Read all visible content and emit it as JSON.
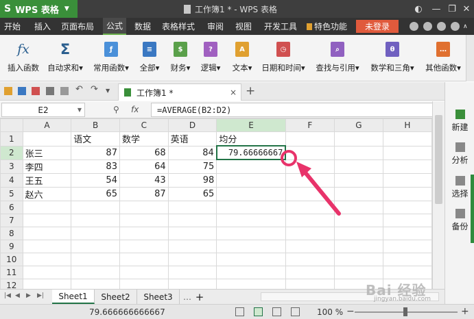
{
  "app": {
    "logo": "S",
    "name": "WPS 表格",
    "doc_title": "工作簿1 * - WPS 表格"
  },
  "menu": {
    "items": [
      "开始",
      "插入",
      "页面布局",
      "公式",
      "数据",
      "表格样式",
      "审阅",
      "视图",
      "开发工具",
      "特色功能"
    ],
    "active_index": 3,
    "login": "未登录"
  },
  "ribbon": {
    "buttons": [
      {
        "label": "插入函数",
        "icon": "fx-icon",
        "glyph": "fx",
        "color": "#2b5f8f"
      },
      {
        "label": "自动求和▾",
        "icon": "sigma-icon",
        "glyph": "Σ",
        "color": "#2b5f8f"
      },
      {
        "label": "常用函数▾",
        "icon": "common-func-icon",
        "glyph": "ƒ",
        "color": "#4a90d9"
      },
      {
        "label": "全部▾",
        "icon": "all-func-icon",
        "glyph": "≡",
        "color": "#3a78c2"
      },
      {
        "label": "财务▾",
        "icon": "finance-icon",
        "glyph": "$",
        "color": "#5aa04a"
      },
      {
        "label": "逻辑▾",
        "icon": "logic-icon",
        "glyph": "?",
        "color": "#a060c0"
      },
      {
        "label": "文本▾",
        "icon": "text-icon",
        "glyph": "A",
        "color": "#e0a030"
      },
      {
        "label": "日期和时间▾",
        "icon": "datetime-icon",
        "glyph": "◷",
        "color": "#d05050"
      },
      {
        "label": "查找与引用▾",
        "icon": "lookup-icon",
        "glyph": "⌕",
        "color": "#9060c0"
      },
      {
        "label": "数学和三角▾",
        "icon": "math-icon",
        "glyph": "θ",
        "color": "#7060c0"
      },
      {
        "label": "其他函数▾",
        "icon": "other-func-icon",
        "glyph": "…",
        "color": "#e07030"
      }
    ]
  },
  "tabs": {
    "doc_tab": "工作簿1 *",
    "close": "×",
    "new": "+"
  },
  "formula_bar": {
    "cell_ref": "E2",
    "fx": "fx",
    "formula": "=AVERAGE(B2:D2)"
  },
  "grid": {
    "columns": [
      "A",
      "B",
      "C",
      "D",
      "E",
      "F",
      "G",
      "H"
    ],
    "selected_column": "E",
    "selected_row": 2,
    "rows": [
      [
        "",
        "语文",
        "数学",
        "英语",
        "均分",
        "",
        "",
        ""
      ],
      [
        "张三",
        "87",
        "68",
        "84",
        "79.66666667",
        "",
        "",
        ""
      ],
      [
        "李四",
        "83",
        "64",
        "75",
        "",
        "",
        "",
        ""
      ],
      [
        "王五",
        "54",
        "43",
        "98",
        "",
        "",
        "",
        ""
      ],
      [
        "赵六",
        "65",
        "87",
        "65",
        "",
        "",
        "",
        ""
      ],
      [
        "",
        "",
        "",
        "",
        "",
        "",
        "",
        ""
      ],
      [
        "",
        "",
        "",
        "",
        "",
        "",
        "",
        ""
      ],
      [
        "",
        "",
        "",
        "",
        "",
        "",
        "",
        ""
      ],
      [
        "",
        "",
        "",
        "",
        "",
        "",
        "",
        ""
      ],
      [
        "",
        "",
        "",
        "",
        "",
        "",
        "",
        ""
      ],
      [
        "",
        "",
        "",
        "",
        "",
        "",
        "",
        ""
      ],
      [
        "",
        "",
        "",
        "",
        "",
        "",
        "",
        ""
      ]
    ]
  },
  "sheets": {
    "tabs": [
      "Sheet1",
      "Sheet2",
      "Sheet3"
    ],
    "active": 0,
    "more": "…",
    "add": "+"
  },
  "status": {
    "value": "79.666666666667",
    "zoom": "100 %",
    "zoom_minus": "−",
    "zoom_plus": "+"
  },
  "task_panel": {
    "items": [
      "新建",
      "分析",
      "选择",
      "备份"
    ]
  },
  "watermark": {
    "text": "Bai 经验",
    "sub": "jingyan.baidu.com"
  }
}
